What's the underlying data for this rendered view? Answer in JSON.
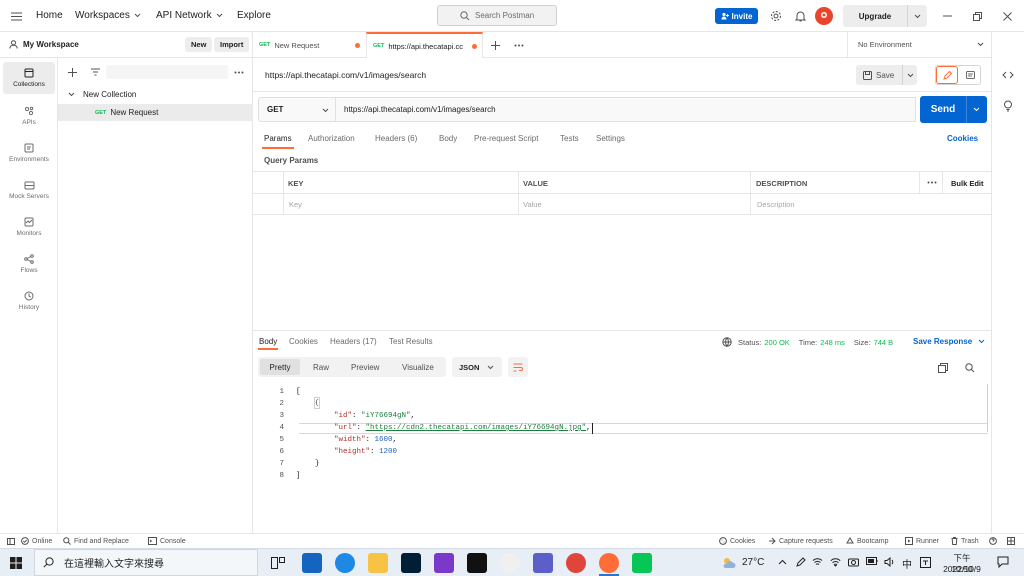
{
  "topbar": {
    "home": "Home",
    "workspaces": "Workspaces",
    "api_network": "API Network",
    "explore": "Explore",
    "search_placeholder": "Search Postman",
    "invite": "Invite",
    "upgrade": "Upgrade"
  },
  "sidebar": {
    "workspace_name": "My Workspace",
    "new_btn": "New",
    "import_btn": "Import",
    "rail": [
      {
        "label": "Collections",
        "icon": "collections-icon"
      },
      {
        "label": "APIs",
        "icon": "apis-icon"
      },
      {
        "label": "Environments",
        "icon": "environments-icon"
      },
      {
        "label": "Mock Servers",
        "icon": "mock-servers-icon"
      },
      {
        "label": "Monitors",
        "icon": "monitors-icon"
      },
      {
        "label": "Flows",
        "icon": "flows-icon"
      },
      {
        "label": "History",
        "icon": "history-icon"
      }
    ],
    "collection_name": "New Collection",
    "request_method": "GET",
    "request_name": "New Request"
  },
  "tabs": [
    {
      "method": "GET",
      "title": "New Request"
    },
    {
      "method": "GET",
      "title": "https://api.thecatapi.cc"
    }
  ],
  "environment": "No Environment",
  "request": {
    "title": "https://api.thecatapi.com/v1/images/search",
    "save_label": "Save",
    "method": "GET",
    "url": "https://api.thecatapi.com/v1/images/search",
    "send_label": "Send",
    "subtabs": [
      "Params",
      "Authorization",
      "Headers (6)",
      "Body",
      "Pre-request Script",
      "Tests",
      "Settings"
    ],
    "cookies_link": "Cookies",
    "query_params_title": "Query Params",
    "table_headers": {
      "key": "KEY",
      "value": "VALUE",
      "description": "DESCRIPTION",
      "bulk_edit": "Bulk Edit"
    },
    "placeholders": {
      "key": "Key",
      "value": "Value",
      "description": "Description"
    }
  },
  "response": {
    "tabs": [
      "Body",
      "Cookies",
      "Headers (17)",
      "Test Results"
    ],
    "status_label": "Status:",
    "status_value": "200 OK",
    "time_label": "Time:",
    "time_value": "248 ms",
    "size_label": "Size:",
    "size_value": "744 B",
    "save_response": "Save Response",
    "view_modes": [
      "Pretty",
      "Raw",
      "Preview",
      "Visualize"
    ],
    "format": "JSON",
    "line_numbers": [
      "1",
      "2",
      "3",
      "4",
      "5",
      "6",
      "7",
      "8"
    ],
    "json": {
      "open_bracket": "[",
      "open_brace": "{",
      "id_key": "\"id\"",
      "id_value": "\"iY76694gN\"",
      "url_key": "\"url\"",
      "url_value": "\"https://cdn2.thecatapi.com/images/iY76694gN.jpg\"",
      "width_key": "\"width\"",
      "width_value": "1600",
      "height_key": "\"height\"",
      "height_value": "1200",
      "close_brace": "}",
      "close_bracket": "]"
    }
  },
  "statusbar": {
    "online": "Online",
    "find_replace": "Find and Replace",
    "console": "Console",
    "cookies": "Cookies",
    "capture": "Capture requests",
    "bootcamp": "Bootcamp",
    "runner": "Runner",
    "trash": "Trash"
  },
  "taskbar": {
    "search_placeholder": "在這裡輸入文字來搜尋",
    "weather": "27°C",
    "ime": "中",
    "time": "下午 10:50",
    "date": "2022/10/9"
  },
  "colors": {
    "accent": "#ff6c37",
    "primary": "#0265d2",
    "success": "#0cbb52"
  }
}
